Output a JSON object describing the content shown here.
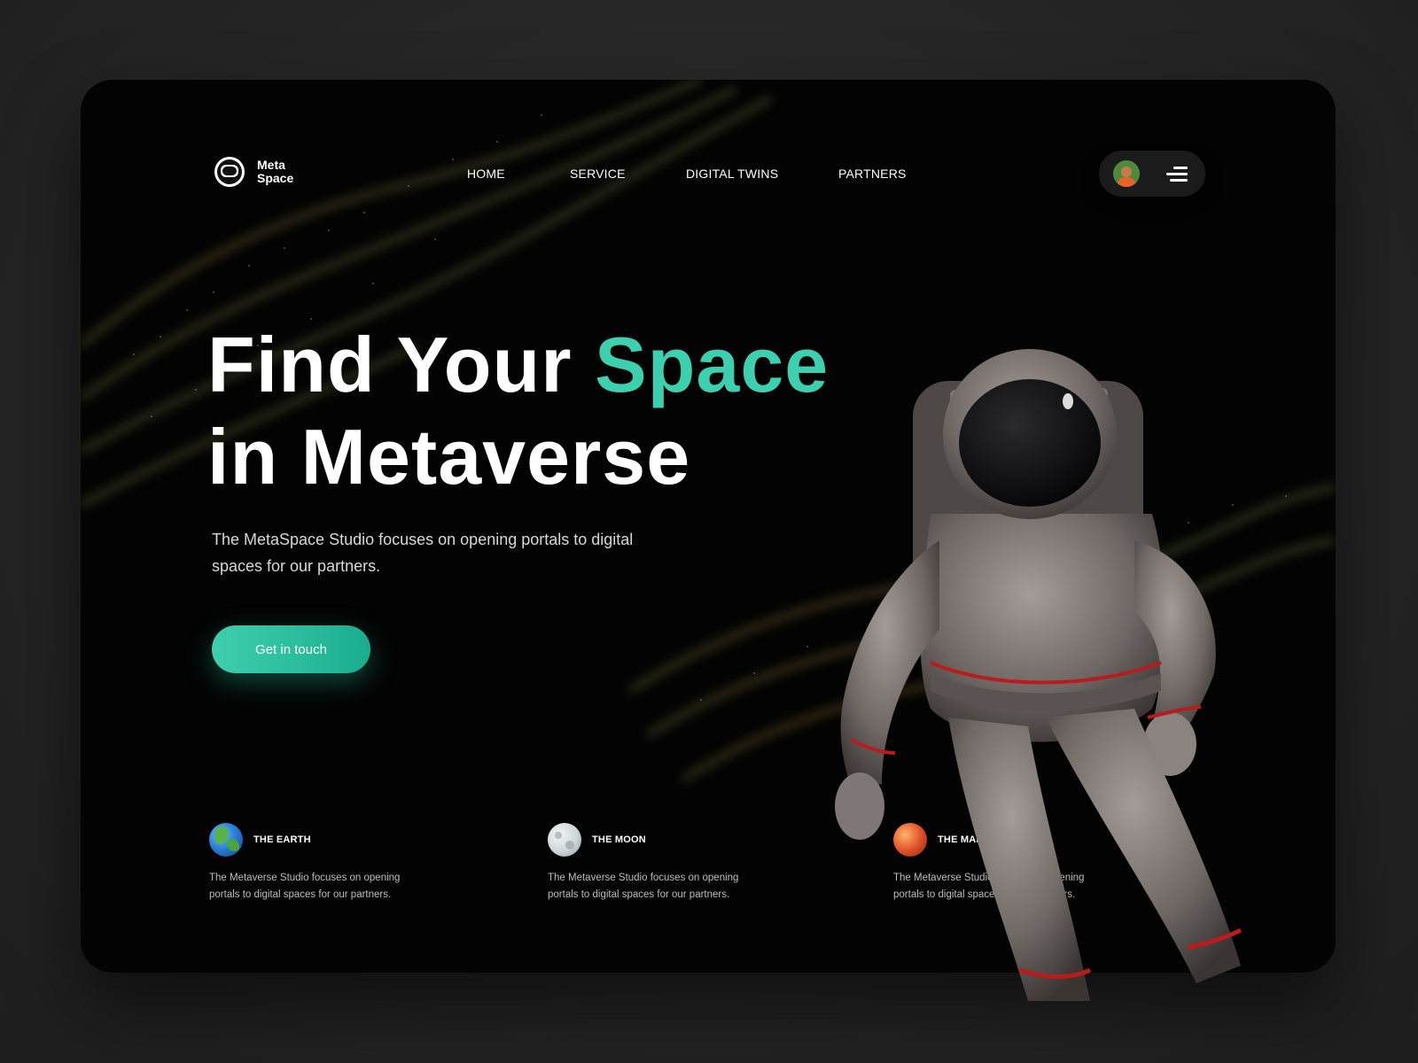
{
  "brand": {
    "line1": "Meta",
    "line2": "Space",
    "logo_icon": "astronaut-helmet-icon"
  },
  "nav": {
    "items": [
      "HOME",
      "SERVICE",
      "DIGITAL TWINS",
      "PARTNERS"
    ]
  },
  "header": {
    "menu_icon": "menu-icon",
    "avatar": "user-avatar"
  },
  "hero": {
    "title_part1": "Find Your ",
    "title_accent": "Space",
    "title_line2": "in Metaverse",
    "subtitle": "The MetaSpace Studio focuses on opening portals to digital spaces for our partners.",
    "cta_label": "Get in touch"
  },
  "features": [
    {
      "title": "THE EARTH",
      "icon": "earth-icon",
      "description": "The Metaverse Studio focuses on opening portals to digital spaces for our partners."
    },
    {
      "title": "THE MOON",
      "icon": "moon-icon",
      "description": "The Metaverse Studio focuses on opening portals to digital spaces for our partners."
    },
    {
      "title": "THE MARS",
      "icon": "mars-icon",
      "description": "The Metaverse Studio focuses on opening portals to digital spaces for our partners."
    }
  ],
  "colors": {
    "accent": "#3ecfae",
    "background": "#030303",
    "page": "#262626"
  }
}
